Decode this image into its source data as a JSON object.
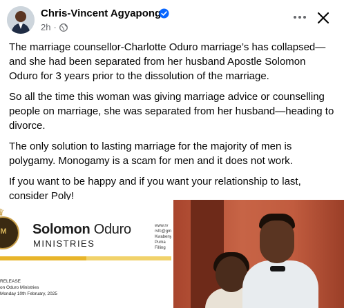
{
  "post": {
    "author": "Chris-Vincent Agyapong",
    "time": "2h",
    "privacy_sep": "·",
    "icons": {
      "verified": "verified-badge-icon",
      "privacy": "globe-icon",
      "more": "more-dots-icon",
      "close": "close-icon"
    },
    "paragraphs": [
      "The marriage counsellor-Charlotte Oduro marriage’s has collapsed—and she had been separated from her husband Apostle Solomon Oduro for 3 years prior to the dissolution of the marriage.",
      "So all the time this woman was giving marriage advice or counselling people on marriage, she was separated from her husband—heading to divorce.",
      "The only solution to lasting marriage for the majority of men is polygamy. Monogamy is a scam for men and it does not work.",
      "If you want to be happy and if you want your relationship to last, consider Poly!"
    ]
  },
  "attachments": {
    "left_image": {
      "logo_text": "OM",
      "brand_bold": "Solomon",
      "brand_regular": " Oduro",
      "brand_sub": "MINISTRIES",
      "contact_lines": [
        "www.rv",
        "rvfc@gm",
        "Kwabeny",
        "Puma Filling"
      ],
      "release_lines": [
        "RELEASE",
        "on Oduro Ministries",
        "Monday 10th February, 2025"
      ]
    },
    "right_image": {
      "description_icon": "photo-couple"
    }
  },
  "colors": {
    "text": "#050505",
    "meta": "#65676b",
    "verified": "#0866ff",
    "brand_yellow": "#e8b52a"
  }
}
